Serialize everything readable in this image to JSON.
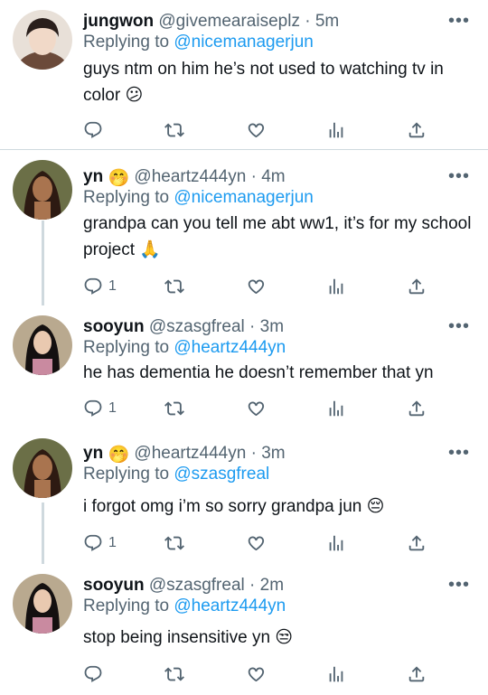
{
  "tweets": [
    {
      "name": "jungwon",
      "handle": "@givemearaiseplz",
      "dot": "·",
      "time": "5m",
      "replying_prefix": "Replying to",
      "replying_to": "@nicemanagerjun",
      "text": "guys ntm on him he’s not used to watching tv in color 😕",
      "reply_count": "",
      "name_emoji": ""
    },
    {
      "name": "yn",
      "name_emoji": "🤭",
      "handle": "@heartz444yn",
      "dot": "·",
      "time": "4m",
      "replying_prefix": "Replying to",
      "replying_to": "@nicemanagerjun",
      "text": "grandpa can you tell me abt ww1, it’s for my school project 🙏",
      "reply_count": "1"
    },
    {
      "name": "sooyun",
      "name_emoji": "",
      "handle": "@szasgfreal",
      "dot": "·",
      "time": "3m",
      "replying_prefix": "Replying to",
      "replying_to": "@heartz444yn",
      "text": "he has dementia he doesn’t remember that yn",
      "reply_count": "1"
    },
    {
      "name": "yn",
      "name_emoji": "🤭",
      "handle": "@heartz444yn",
      "dot": "·",
      "time": "3m",
      "replying_prefix": "Replying to",
      "replying_to": "@szasgfreal",
      "text": "i forgot omg i’m so sorry grandpa jun 😔",
      "reply_count": "1"
    },
    {
      "name": "sooyun",
      "name_emoji": "",
      "handle": "@szasgfreal",
      "dot": "·",
      "time": "2m",
      "replying_prefix": "Replying to",
      "replying_to": "@heartz444yn",
      "text": "stop being insensitive yn 😒",
      "reply_count": ""
    }
  ],
  "more_label": "•••",
  "icons": {
    "reply": "reply-icon",
    "retweet": "retweet-icon",
    "like": "heart-icon",
    "analytics": "analytics-icon",
    "share": "share-icon"
  },
  "colors": {
    "link": "#1d9bf0",
    "secondary": "#536471",
    "divider": "#cfd9de"
  }
}
